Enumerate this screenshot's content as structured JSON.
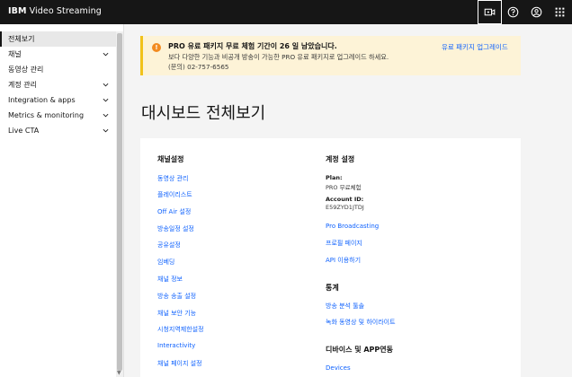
{
  "topbar": {
    "brand_prefix": "IBM",
    "brand_name": "Video Streaming",
    "icons": [
      "video-camera-icon",
      "help-icon",
      "user-icon",
      "app-grid-icon"
    ]
  },
  "sidebar": {
    "items": [
      {
        "label": "전체보기",
        "expandable": false,
        "active": true
      },
      {
        "label": "채널",
        "expandable": true
      },
      {
        "label": "동영상 관리",
        "expandable": false
      },
      {
        "label": "계정 관리",
        "expandable": true
      },
      {
        "label": "Integration & apps",
        "expandable": true
      },
      {
        "label": "Metrics & monitoring",
        "expandable": true
      },
      {
        "label": "Live CTA",
        "expandable": true
      }
    ]
  },
  "banner": {
    "title": "PRO 유료 패키지 무료 체험 기간이 26 일 남았습니다.",
    "description": "보다 다양한 기능과 비공개 방송이 가능한 PRO 유료 패키지로 업그레이드 하세요.",
    "contact": "(문의) 02-757-6565",
    "upgrade_link": "유료 패키지 업그레이드"
  },
  "page_title": "대시보드 전체보기",
  "channel_settings": {
    "title": "채널설정",
    "links": [
      "동영상 관리",
      "플레이리스트",
      "Off Air 설정",
      "방송일정 설정",
      "공유설정",
      "임베딩",
      "채널 정보",
      "방송 송출 설정",
      "채널 보안 기능",
      "시청지역제한설정",
      "Interactivity",
      "채널 페이지 설정"
    ]
  },
  "account_settings": {
    "title": "계정 설정",
    "plan_label": "Plan:",
    "plan_value": "PRO 무료체험",
    "account_id_label": "Account ID:",
    "account_id_value": "E59ZYD1JTDJ",
    "links": [
      "Pro Broadcasting",
      "프로필 페이지",
      "API 이용하기"
    ]
  },
  "stats": {
    "title": "통계",
    "links": [
      "방송 분석 툴솔",
      "녹화 동영상 및 하이라이트"
    ]
  },
  "devices": {
    "title": "디바이스 및 APP연동",
    "links": [
      "Devices"
    ]
  }
}
